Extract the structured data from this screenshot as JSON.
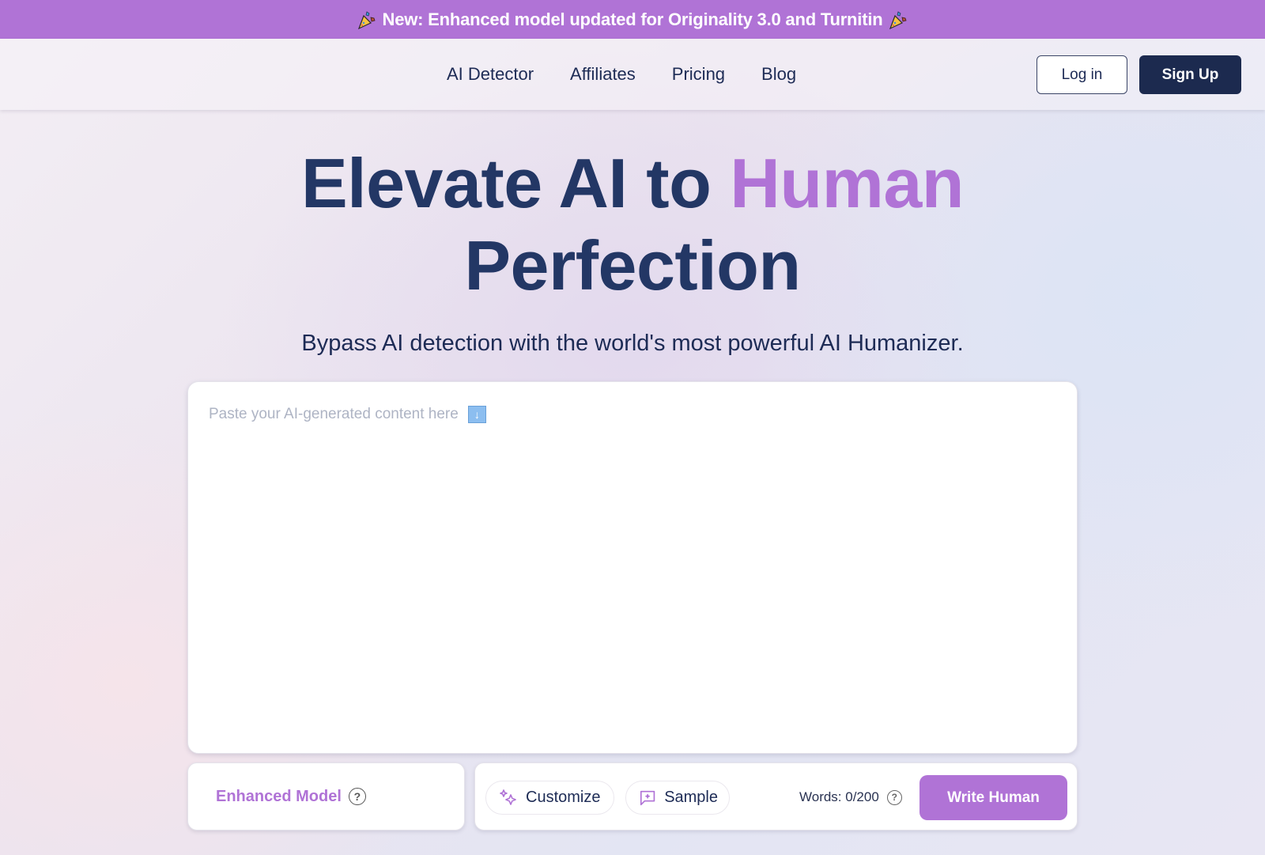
{
  "announcement": {
    "text": "New: Enhanced model updated for Originality 3.0 and Turnitin",
    "icon_left": "party-popper-icon",
    "icon_right": "party-popper-icon"
  },
  "nav": {
    "links": [
      {
        "label": "AI Detector"
      },
      {
        "label": "Affiliates"
      },
      {
        "label": "Pricing"
      },
      {
        "label": "Blog"
      }
    ],
    "login_label": "Log in",
    "signup_label": "Sign Up"
  },
  "hero": {
    "title_part1": "Elevate AI to ",
    "title_accent": "Human",
    "title_part2": "Perfection",
    "subtitle": "Bypass AI detection with the world's most powerful AI Humanizer."
  },
  "editor": {
    "value": "",
    "placeholder": "Paste your AI-generated content here",
    "placeholder_icon": "down-arrow-icon",
    "placeholder_icon_glyph": "↓"
  },
  "model": {
    "label": "Enhanced Model",
    "help_glyph": "?"
  },
  "actions": {
    "customize_label": "Customize",
    "sample_label": "Sample",
    "word_count": "Words: 0/200",
    "help_glyph": "?",
    "write_label": "Write Human"
  },
  "colors": {
    "accent": "#b073d6",
    "navy": "#1c2a4f",
    "title": "#233765"
  }
}
